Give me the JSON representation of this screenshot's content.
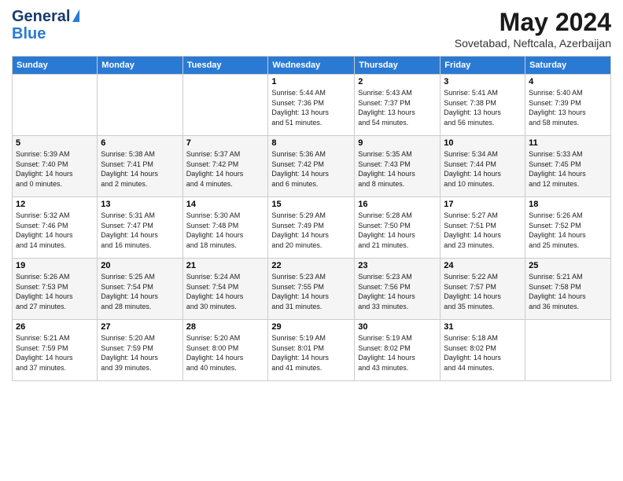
{
  "logo": {
    "line1": "General",
    "line2": "Blue"
  },
  "header": {
    "month": "May 2024",
    "location": "Sovetabad, Neftcala, Azerbaijan"
  },
  "days_of_week": [
    "Sunday",
    "Monday",
    "Tuesday",
    "Wednesday",
    "Thursday",
    "Friday",
    "Saturday"
  ],
  "weeks": [
    [
      {
        "day": "",
        "info": ""
      },
      {
        "day": "",
        "info": ""
      },
      {
        "day": "",
        "info": ""
      },
      {
        "day": "1",
        "info": "Sunrise: 5:44 AM\nSunset: 7:36 PM\nDaylight: 13 hours\nand 51 minutes."
      },
      {
        "day": "2",
        "info": "Sunrise: 5:43 AM\nSunset: 7:37 PM\nDaylight: 13 hours\nand 54 minutes."
      },
      {
        "day": "3",
        "info": "Sunrise: 5:41 AM\nSunset: 7:38 PM\nDaylight: 13 hours\nand 56 minutes."
      },
      {
        "day": "4",
        "info": "Sunrise: 5:40 AM\nSunset: 7:39 PM\nDaylight: 13 hours\nand 58 minutes."
      }
    ],
    [
      {
        "day": "5",
        "info": "Sunrise: 5:39 AM\nSunset: 7:40 PM\nDaylight: 14 hours\nand 0 minutes."
      },
      {
        "day": "6",
        "info": "Sunrise: 5:38 AM\nSunset: 7:41 PM\nDaylight: 14 hours\nand 2 minutes."
      },
      {
        "day": "7",
        "info": "Sunrise: 5:37 AM\nSunset: 7:42 PM\nDaylight: 14 hours\nand 4 minutes."
      },
      {
        "day": "8",
        "info": "Sunrise: 5:36 AM\nSunset: 7:42 PM\nDaylight: 14 hours\nand 6 minutes."
      },
      {
        "day": "9",
        "info": "Sunrise: 5:35 AM\nSunset: 7:43 PM\nDaylight: 14 hours\nand 8 minutes."
      },
      {
        "day": "10",
        "info": "Sunrise: 5:34 AM\nSunset: 7:44 PM\nDaylight: 14 hours\nand 10 minutes."
      },
      {
        "day": "11",
        "info": "Sunrise: 5:33 AM\nSunset: 7:45 PM\nDaylight: 14 hours\nand 12 minutes."
      }
    ],
    [
      {
        "day": "12",
        "info": "Sunrise: 5:32 AM\nSunset: 7:46 PM\nDaylight: 14 hours\nand 14 minutes."
      },
      {
        "day": "13",
        "info": "Sunrise: 5:31 AM\nSunset: 7:47 PM\nDaylight: 14 hours\nand 16 minutes."
      },
      {
        "day": "14",
        "info": "Sunrise: 5:30 AM\nSunset: 7:48 PM\nDaylight: 14 hours\nand 18 minutes."
      },
      {
        "day": "15",
        "info": "Sunrise: 5:29 AM\nSunset: 7:49 PM\nDaylight: 14 hours\nand 20 minutes."
      },
      {
        "day": "16",
        "info": "Sunrise: 5:28 AM\nSunset: 7:50 PM\nDaylight: 14 hours\nand 21 minutes."
      },
      {
        "day": "17",
        "info": "Sunrise: 5:27 AM\nSunset: 7:51 PM\nDaylight: 14 hours\nand 23 minutes."
      },
      {
        "day": "18",
        "info": "Sunrise: 5:26 AM\nSunset: 7:52 PM\nDaylight: 14 hours\nand 25 minutes."
      }
    ],
    [
      {
        "day": "19",
        "info": "Sunrise: 5:26 AM\nSunset: 7:53 PM\nDaylight: 14 hours\nand 27 minutes."
      },
      {
        "day": "20",
        "info": "Sunrise: 5:25 AM\nSunset: 7:54 PM\nDaylight: 14 hours\nand 28 minutes."
      },
      {
        "day": "21",
        "info": "Sunrise: 5:24 AM\nSunset: 7:54 PM\nDaylight: 14 hours\nand 30 minutes."
      },
      {
        "day": "22",
        "info": "Sunrise: 5:23 AM\nSunset: 7:55 PM\nDaylight: 14 hours\nand 31 minutes."
      },
      {
        "day": "23",
        "info": "Sunrise: 5:23 AM\nSunset: 7:56 PM\nDaylight: 14 hours\nand 33 minutes."
      },
      {
        "day": "24",
        "info": "Sunrise: 5:22 AM\nSunset: 7:57 PM\nDaylight: 14 hours\nand 35 minutes."
      },
      {
        "day": "25",
        "info": "Sunrise: 5:21 AM\nSunset: 7:58 PM\nDaylight: 14 hours\nand 36 minutes."
      }
    ],
    [
      {
        "day": "26",
        "info": "Sunrise: 5:21 AM\nSunset: 7:59 PM\nDaylight: 14 hours\nand 37 minutes."
      },
      {
        "day": "27",
        "info": "Sunrise: 5:20 AM\nSunset: 7:59 PM\nDaylight: 14 hours\nand 39 minutes."
      },
      {
        "day": "28",
        "info": "Sunrise: 5:20 AM\nSunset: 8:00 PM\nDaylight: 14 hours\nand 40 minutes."
      },
      {
        "day": "29",
        "info": "Sunrise: 5:19 AM\nSunset: 8:01 PM\nDaylight: 14 hours\nand 41 minutes."
      },
      {
        "day": "30",
        "info": "Sunrise: 5:19 AM\nSunset: 8:02 PM\nDaylight: 14 hours\nand 43 minutes."
      },
      {
        "day": "31",
        "info": "Sunrise: 5:18 AM\nSunset: 8:02 PM\nDaylight: 14 hours\nand 44 minutes."
      },
      {
        "day": "",
        "info": ""
      }
    ]
  ]
}
